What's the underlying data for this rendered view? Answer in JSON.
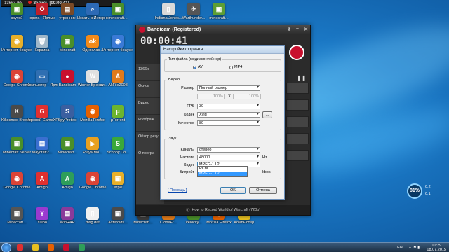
{
  "recbar": {
    "resolution": "1366x768",
    "recording": "Запись [00:00:41]"
  },
  "desktop_icons": [
    {
      "label": "крутой",
      "color": "#4a8f2a",
      "glyph": "▣"
    },
    {
      "label": "opera - Ярлык",
      "color": "#c0202a",
      "glyph": "O"
    },
    {
      "label": "утренник",
      "color": "#7b4a26",
      "glyph": "▤"
    },
    {
      "label": "Искать в Интернете",
      "color": "#2d6ab5",
      "glyph": "⌕"
    },
    {
      "label": "minecraft...",
      "color": "#4a8f2a",
      "glyph": "▣"
    },
    {
      "label": "Indiana Jones...",
      "color": "#d9d9d9",
      "glyph": "▯"
    },
    {
      "label": "Warthunder...",
      "color": "#555555",
      "glyph": "✈"
    },
    {
      "label": "minecraft...",
      "color": "#5e9e34",
      "glyph": "▣"
    },
    {
      "label": "Интернет браузе...",
      "color": "#e8b02a",
      "glyph": "◉"
    },
    {
      "label": "Корзина",
      "color": "#9fb7c9",
      "glyph": "🗑"
    },
    {
      "label": "Minecraft",
      "color": "#4a8f2a",
      "glyph": "▣"
    },
    {
      "label": "Одноклас...",
      "color": "#f28a1a",
      "glyph": "ok"
    },
    {
      "label": "Интернет браузе...",
      "color": "#3a7ad6",
      "glyph": "◉"
    },
    {
      "label": "Google Chrome",
      "color": "#db4437",
      "glyph": "◉"
    },
    {
      "label": "Компьютер - Ярлык",
      "color": "#2f6fb2",
      "glyph": "▭"
    },
    {
      "label": "Bandicam",
      "color": "#c8102e",
      "glyph": "●"
    },
    {
      "label": "Winner Бренди...",
      "color": "#e0e0e0",
      "glyph": "W"
    },
    {
      "label": "AltFile2008",
      "color": "#e07a1a",
      "glyph": "A"
    },
    {
      "label": "Kikosmos Browser",
      "color": "#4a4a4a",
      "glyph": "K"
    },
    {
      "label": "Игровой GameXP",
      "color": "#e03030",
      "glyph": "G"
    },
    {
      "label": "SpyProtect",
      "color": "#3a5fa0",
      "glyph": "S"
    },
    {
      "label": "Mozilla Firefox",
      "color": "#e66000",
      "glyph": "◉"
    },
    {
      "label": "μTorrent",
      "color": "#6cb52d",
      "glyph": "μ"
    },
    {
      "label": "Minecraft Server",
      "color": "#4a8f2a",
      "glyph": "▣"
    },
    {
      "label": "Maycraft2...",
      "color": "#3a6fd0",
      "glyph": "▤"
    },
    {
      "label": "Minecraft...",
      "color": "#4a8f2a",
      "glyph": "▣"
    },
    {
      "label": "PlayMMo...",
      "color": "#e8a020",
      "glyph": "▶"
    },
    {
      "label": "Scooby Do...",
      "color": "#3aa83a",
      "glyph": "S"
    },
    {
      "label": "Google Chrome",
      "color": "#db4437",
      "glyph": "◉"
    },
    {
      "label": "Amigo",
      "color": "#e03030",
      "glyph": "A"
    },
    {
      "label": "Amigo",
      "color": "#2e9e5a",
      "glyph": "A"
    },
    {
      "label": "Google Chrome",
      "color": "#db4437",
      "glyph": "◉"
    },
    {
      "label": "Игры",
      "color": "#e8b02a",
      "glyph": "▣"
    },
    {
      "label": "Minecraft...",
      "color": "#555555",
      "glyph": "▣"
    },
    {
      "label": "Yuloo",
      "color": "#9a3ad0",
      "glyph": "Y"
    },
    {
      "label": "WinRAR",
      "color": "#8a3a9a",
      "glyph": "▤"
    },
    {
      "label": "msg.dat",
      "color": "#f0f0f0",
      "glyph": "▯"
    },
    {
      "label": "Asteroids...",
      "color": "#4a4a4a",
      "glyph": "▣"
    },
    {
      "label": "Minecraft...",
      "color": "#3a3a3a",
      "glyph": "▣"
    },
    {
      "label": "CloneFr...",
      "color": "#e07a1a",
      "glyph": "C"
    },
    {
      "label": "Velocity...",
      "color": "#4a8f2a",
      "glyph": "V"
    },
    {
      "label": "Mozilla Firefox",
      "color": "#e66000",
      "glyph": "◉"
    },
    {
      "label": "Компьютер",
      "color": "#e8c020",
      "glyph": "▭"
    }
  ],
  "bandicam": {
    "title": "Bandicam (Registered)",
    "timer": "00:00:41",
    "resolution": "1366x",
    "side": [
      "Основ",
      "Видео",
      "Изображ",
      "Обзор резу",
      "О програ"
    ],
    "footer": "How to Record World of Warcraft (720p)"
  },
  "dialog": {
    "title": "Настройки формата",
    "file_type_legend": "Тип файла (медиаконтейнер)",
    "avi": "AVI",
    "mp4": "MP4",
    "video_legend": "Видео",
    "size_label": "Размер",
    "size_value": "Полный размер",
    "width_pct": "100%",
    "x": "X",
    "height_pct": "100%",
    "fps_label": "FPS",
    "fps_value": "30",
    "codec_label": "Кодек",
    "codec_value": "Xvid",
    "codec_more": "...",
    "quality_label": "Качество",
    "quality_value": "80",
    "audio_legend": "Звук",
    "channels_label": "Каналы",
    "channels_value": "стерео",
    "freq_label": "Частота",
    "freq_value": "48000",
    "hz": "Hz",
    "acodec_label": "Кодек",
    "acodec_value": "MPEG-1 L2",
    "bitrate_label": "Битрейт",
    "kbps": "kbps",
    "dropdown": [
      "PCM",
      "MPEG-1 L2"
    ],
    "help": "[ Помощь ]",
    "ok": "OK",
    "cancel": "Отмена"
  },
  "gadget": {
    "percent": "81%",
    "v1": "0,2",
    "v2": "0,1"
  },
  "taskbar": {
    "apps": [
      {
        "color": "#e03030"
      },
      {
        "color": "#e8c020"
      },
      {
        "color": "#e66000"
      },
      {
        "color": "#c8102e"
      },
      {
        "color": "#2e9e5a"
      }
    ],
    "lang": "EN",
    "time": "10:29",
    "date": "08.07.2015"
  }
}
